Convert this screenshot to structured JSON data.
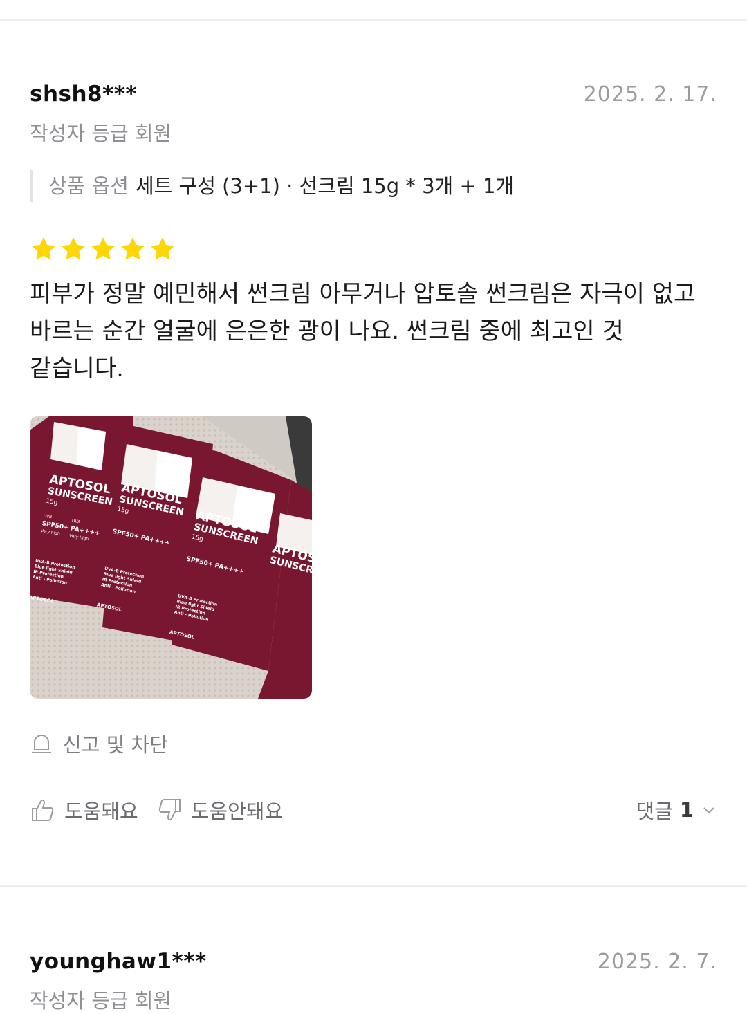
{
  "reviews": [
    {
      "username": "shsh8***",
      "date": "2025. 2. 17.",
      "grade": "작성자 등급 회원",
      "option_label": "상품 옵션",
      "option_value": "세트 구성 (3+1) · 선크림 15g * 3개 + 1개",
      "rating": 5,
      "content": "피부가 정말 예민해서 썬크림 아무거나 압토솔 썬크림은 자극이 없고 바르는 순간 얼굴에 은은한 광이 나요. 썬크림 중에 최고인 것 같습니다.",
      "photo": {
        "brand": "APTOSOL",
        "product": "SUNSCREEN",
        "size": "15g",
        "uvb_label": "UVB",
        "spf": "SPF50+",
        "uva_label": "UVA",
        "pa": "PA++++",
        "level": "Very high",
        "claims": [
          "UVA-B Protection",
          "Blue light Shield",
          "IR Protection",
          "Anti - Pollution"
        ]
      },
      "report_label": "신고 및 차단",
      "helpful_label": "도움돼요",
      "not_helpful_label": "도움안돼요",
      "comments_label": "댓글",
      "comments_count": "1"
    },
    {
      "username": "younghaw1***",
      "date": "2025. 2. 7.",
      "grade": "작성자 등급 회원"
    }
  ],
  "colors": {
    "star": "#FFD700",
    "box": "#7A1730",
    "muted": "#8E8E93"
  },
  "icons": {
    "star": "star-icon",
    "report": "bell-icon",
    "helpful": "thumbs-up-icon",
    "not_helpful": "thumbs-down-icon",
    "expand": "chevron-down-icon"
  }
}
